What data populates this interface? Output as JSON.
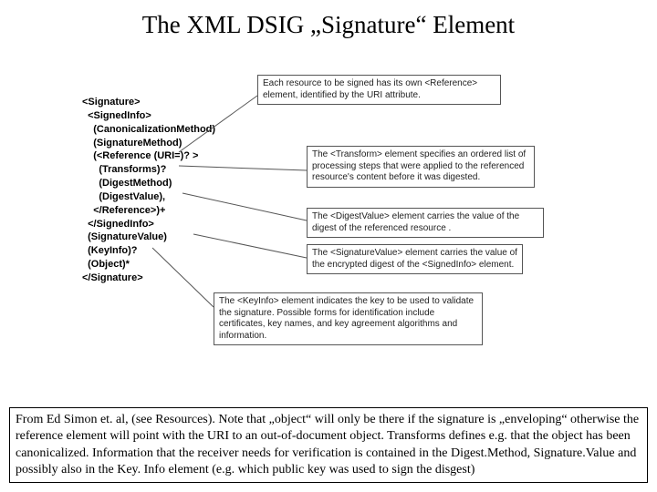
{
  "title": "The XML DSIG „Signature“ Element",
  "code": {
    "l1": "<Signature>",
    "l2": "  <SignedInfo>",
    "l3": "    (CanonicalizationMethod)",
    "l4": "    (SignatureMethod)",
    "l5": "    (<Reference (URI=)? >",
    "l6": "      (Transforms)?",
    "l7": "      (DigestMethod)",
    "l8": "      (DigestValue),",
    "l9": "    </Reference>)+",
    "l10": "  </SignedInfo>",
    "l11": "  (SignatureValue)",
    "l12": "  (KeyInfo)?",
    "l13": "  (Object)*",
    "l14": "</Signature>"
  },
  "callouts": {
    "reference": "Each resource to be signed has its own <Reference> element, identified by the URI attribute.",
    "transform": "The <Transform> element specifies an ordered list of processing steps that were applied to the referenced resource's content before it was digested.",
    "digest": "The <DigestValue> element carries the value of the digest of the referenced resource .",
    "sigvalue": "The <SignatureValue> element carries the value of the encrypted digest of the <SignedInfo> element.",
    "keyinfo": "The <KeyInfo> element indicates the key to be used to validate the signature. Possible forms for identification include certificates, key names, and key agreement algorithms and information."
  },
  "footnote": "From Ed Simon et. al, (see Resources). Note that „object“ will only be there if the signature is „enveloping“ otherwise the reference element will point with the URI to an out-of-document object. Transforms defines e.g. that the object has been canonicalized. Information that the receiver needs for verification is contained in the Digest.Method, Signature.Value and possibly also in the Key. Info element (e.g. which public key was used to sign the disgest)"
}
